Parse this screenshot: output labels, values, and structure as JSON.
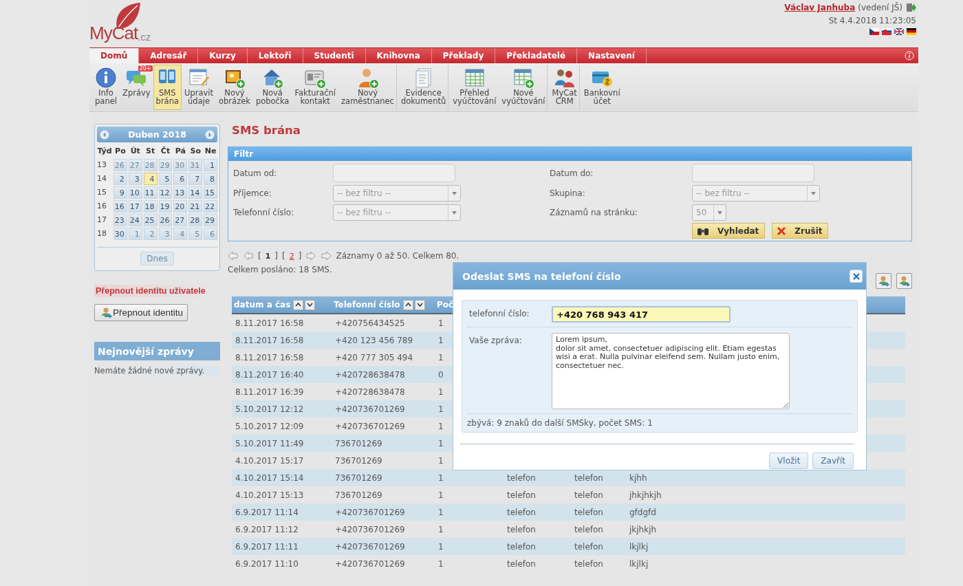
{
  "header": {
    "logo": {
      "main": "MyCat",
      "suffix": ".cz"
    },
    "user": "Václav Janhuba",
    "role": "(vedení JŠ)",
    "datetime": "St 4.4.2018 11:23:05",
    "flags": [
      {
        "kind": "cz"
      },
      {
        "kind": "sk"
      },
      {
        "kind": "gb"
      },
      {
        "kind": "de"
      }
    ]
  },
  "nav": {
    "tabs": [
      {
        "label": "Domů",
        "selected": true
      },
      {
        "label": "Adresář",
        "selected": false
      },
      {
        "label": "Kurzy",
        "selected": false
      },
      {
        "label": "Lektoři",
        "selected": false
      },
      {
        "label": "Studenti",
        "selected": false
      },
      {
        "label": "Knihovna",
        "selected": false
      },
      {
        "label": "Překlady",
        "selected": false
      },
      {
        "label": "Překladatelé",
        "selected": false
      },
      {
        "label": "Nastavení",
        "selected": false
      }
    ]
  },
  "toolbar": [
    {
      "label": "Info\npanel",
      "kind": "info",
      "selected": false,
      "group_end": false
    },
    {
      "label": "Zprávy",
      "kind": "chat",
      "selected": false,
      "badge": "20+",
      "group_end": false
    },
    {
      "label": "SMS\nbrána",
      "kind": "phone",
      "selected": true,
      "group_end": false
    },
    {
      "label": "Upravit\núdaje",
      "kind": "form",
      "selected": false,
      "group_end": false
    },
    {
      "label": "Nový\nobrázek",
      "kind": "image",
      "selected": false,
      "group_end": false
    },
    {
      "label": "Nová\npobočka",
      "kind": "house",
      "selected": false,
      "group_end": false
    },
    {
      "label": "Fakturační\nkontakt",
      "kind": "contact",
      "selected": false,
      "group_end": false
    },
    {
      "label": "Nový\nzaměstnanec",
      "kind": "person",
      "selected": false,
      "group_end": true
    },
    {
      "label": "Evidence\ndokumentů",
      "kind": "document",
      "selected": false,
      "group_end": true
    },
    {
      "label": "Přehled\nvyúčtování",
      "kind": "table",
      "selected": false,
      "group_end": false
    },
    {
      "label": "Nové\nvyúčtování",
      "kind": "table-add",
      "selected": false,
      "group_end": true
    },
    {
      "label": "MyCat\nCRM",
      "kind": "people",
      "selected": false,
      "group_end": true
    },
    {
      "label": "Bankovní\núčet",
      "kind": "card",
      "selected": false,
      "group_end": false
    }
  ],
  "calendar": {
    "month": "Duben 2018",
    "weekdays": [
      "Týd",
      "Po",
      "Út",
      "St",
      "Čt",
      "Pá",
      "So",
      "Ne"
    ],
    "today_button": "Dnes",
    "weeks": [
      {
        "week": "13",
        "days": [
          {
            "label": "26",
            "muted": true,
            "selected": false
          },
          {
            "label": "27",
            "muted": true,
            "selected": false
          },
          {
            "label": "28",
            "muted": true,
            "selected": false
          },
          {
            "label": "29",
            "muted": true,
            "selected": false
          },
          {
            "label": "30",
            "muted": true,
            "selected": false
          },
          {
            "label": "31",
            "muted": true,
            "selected": false
          },
          {
            "label": "1",
            "muted": false,
            "selected": false
          }
        ]
      },
      {
        "week": "14",
        "days": [
          {
            "label": "2",
            "muted": false,
            "selected": false
          },
          {
            "label": "3",
            "muted": false,
            "selected": false
          },
          {
            "label": "4",
            "muted": false,
            "selected": true
          },
          {
            "label": "5",
            "muted": false,
            "selected": false
          },
          {
            "label": "6",
            "muted": false,
            "selected": false
          },
          {
            "label": "7",
            "muted": false,
            "selected": false
          },
          {
            "label": "8",
            "muted": false,
            "selected": false
          }
        ]
      },
      {
        "week": "15",
        "days": [
          {
            "label": "9",
            "muted": false,
            "selected": false
          },
          {
            "label": "10",
            "muted": false,
            "selected": false
          },
          {
            "label": "11",
            "muted": false,
            "selected": false
          },
          {
            "label": "12",
            "muted": false,
            "selected": false
          },
          {
            "label": "13",
            "muted": false,
            "selected": false
          },
          {
            "label": "14",
            "muted": false,
            "selected": false
          },
          {
            "label": "15",
            "muted": false,
            "selected": false
          }
        ]
      },
      {
        "week": "16",
        "days": [
          {
            "label": "16",
            "muted": false,
            "selected": false
          },
          {
            "label": "17",
            "muted": false,
            "selected": false
          },
          {
            "label": "18",
            "muted": false,
            "selected": false
          },
          {
            "label": "19",
            "muted": false,
            "selected": false
          },
          {
            "label": "20",
            "muted": false,
            "selected": false
          },
          {
            "label": "21",
            "muted": false,
            "selected": false
          },
          {
            "label": "22",
            "muted": false,
            "selected": false
          }
        ]
      },
      {
        "week": "17",
        "days": [
          {
            "label": "23",
            "muted": false,
            "selected": false
          },
          {
            "label": "24",
            "muted": false,
            "selected": false
          },
          {
            "label": "25",
            "muted": false,
            "selected": false
          },
          {
            "label": "26",
            "muted": false,
            "selected": false
          },
          {
            "label": "27",
            "muted": false,
            "selected": false
          },
          {
            "label": "28",
            "muted": false,
            "selected": false
          },
          {
            "label": "29",
            "muted": false,
            "selected": false
          }
        ]
      },
      {
        "week": "18",
        "days": [
          {
            "label": "30",
            "muted": false,
            "selected": false
          },
          {
            "label": "1",
            "muted": true,
            "selected": false
          },
          {
            "label": "2",
            "muted": true,
            "selected": false
          },
          {
            "label": "3",
            "muted": true,
            "selected": false
          },
          {
            "label": "4",
            "muted": true,
            "selected": false
          },
          {
            "label": "5",
            "muted": true,
            "selected": false
          },
          {
            "label": "6",
            "muted": true,
            "selected": false
          }
        ]
      }
    ]
  },
  "identity": {
    "title": "Přepnout identitu uživatele",
    "button": "Přepnout identitu"
  },
  "news": {
    "title": "Nejnovější zprávy",
    "empty": "Nemáte žádné nové zprávy."
  },
  "page_title": "SMS brána",
  "filter": {
    "title": "Filtr",
    "fields": [
      {
        "label": "Datum od:",
        "kind": "input"
      },
      {
        "label": "Datum do:",
        "kind": "input"
      },
      {
        "label": "Příjemce:",
        "kind": "select",
        "value": "-- bez filtru --"
      },
      {
        "label": "Skupina:",
        "kind": "select",
        "value": "-- bez filtru --"
      },
      {
        "label": "Telefonní číslo:",
        "kind": "select",
        "value": "-- bez filtru --"
      },
      {
        "label": "Záznamů na stránku:",
        "kind": "select",
        "value": "50"
      }
    ],
    "buttons": [
      {
        "label": "Vyhledat",
        "kind": "binoculars"
      },
      {
        "label": "Zrušit",
        "kind": "cross"
      }
    ]
  },
  "pagination": {
    "brackets": [
      "[",
      "]"
    ],
    "pages": [
      {
        "label": "1",
        "selected": true
      },
      {
        "label": "2",
        "selected": false
      }
    ],
    "summary": "Záznamy 0 až 50. Celkem 80."
  },
  "sent_total": "Celkem posláno: 18 SMS.",
  "table": {
    "columns": [
      {
        "label": "datum a čas",
        "sortable": true
      },
      {
        "label": "Telefonní číslo",
        "sortable": true
      },
      {
        "label": "Poč"
      }
    ],
    "rows": [
      {
        "cells": [
          "8.11.2017 16:58",
          "+420756434525",
          "1"
        ]
      },
      {
        "cells": [
          "8.11.2017 16:58",
          "+420 123 456 789",
          "1"
        ]
      },
      {
        "cells": [
          "8.11.2017 16:58",
          "+420 777 305 494",
          "1"
        ]
      },
      {
        "cells": [
          "8.11.2017 16:40",
          "+420728638478",
          "0"
        ]
      },
      {
        "cells": [
          "8.11.2017 16:39",
          "+420728638478",
          "1"
        ]
      },
      {
        "cells": [
          "5.10.2017 12:12",
          "+420736701269",
          "1"
        ]
      },
      {
        "cells": [
          "5.10.2017 12:09",
          "+420736701269",
          "1"
        ]
      },
      {
        "cells": [
          "5.10.2017 11:49",
          "736701269",
          "1"
        ]
      },
      {
        "cells": [
          "4.10.2017 15:17",
          "736701269",
          "1"
        ]
      },
      {
        "cells": [
          "4.10.2017 15:14",
          "736701269",
          "1",
          "telefon",
          "telefon",
          "kjhh"
        ]
      },
      {
        "cells": [
          "4.10.2017 15:13",
          "736701269",
          "1",
          "telefon",
          "telefon",
          "jhkjhkjh"
        ]
      },
      {
        "cells": [
          "6.9.2017 11:14",
          "+420736701269",
          "1",
          "telefon",
          "telefon",
          "gfdgfd"
        ]
      },
      {
        "cells": [
          "6.9.2017 11:12",
          "+420736701269",
          "1",
          "telefon",
          "telefon",
          "jkjhkjh"
        ]
      },
      {
        "cells": [
          "6.9.2017 11:11",
          "+420736701269",
          "1",
          "telefon",
          "telefon",
          "lkjlkj"
        ]
      },
      {
        "cells": [
          "6.9.2017 11:10",
          "+420736701269",
          "1",
          "telefon",
          "telefon",
          "lkjlkj"
        ]
      }
    ]
  },
  "dialog": {
    "title": "Odeslat SMS na telefoní číslo",
    "phone_label": "telefonní číslo:",
    "phone_value": "+420 768 943 417",
    "message_label": "Vaše zpráva:",
    "message": "Lorem ipsum,\ndolor sit amet, consectetuer adipiscing elit. Etiam egestas wisi a erat. Nulla pulvinar eleifend sem. Nullam justo enim, consectetuer nec.",
    "remaining": "zbývá: 9 znaků do další SMSky, počet SMS: 1",
    "buttons": [
      "Vložit",
      "Zavřít"
    ]
  }
}
